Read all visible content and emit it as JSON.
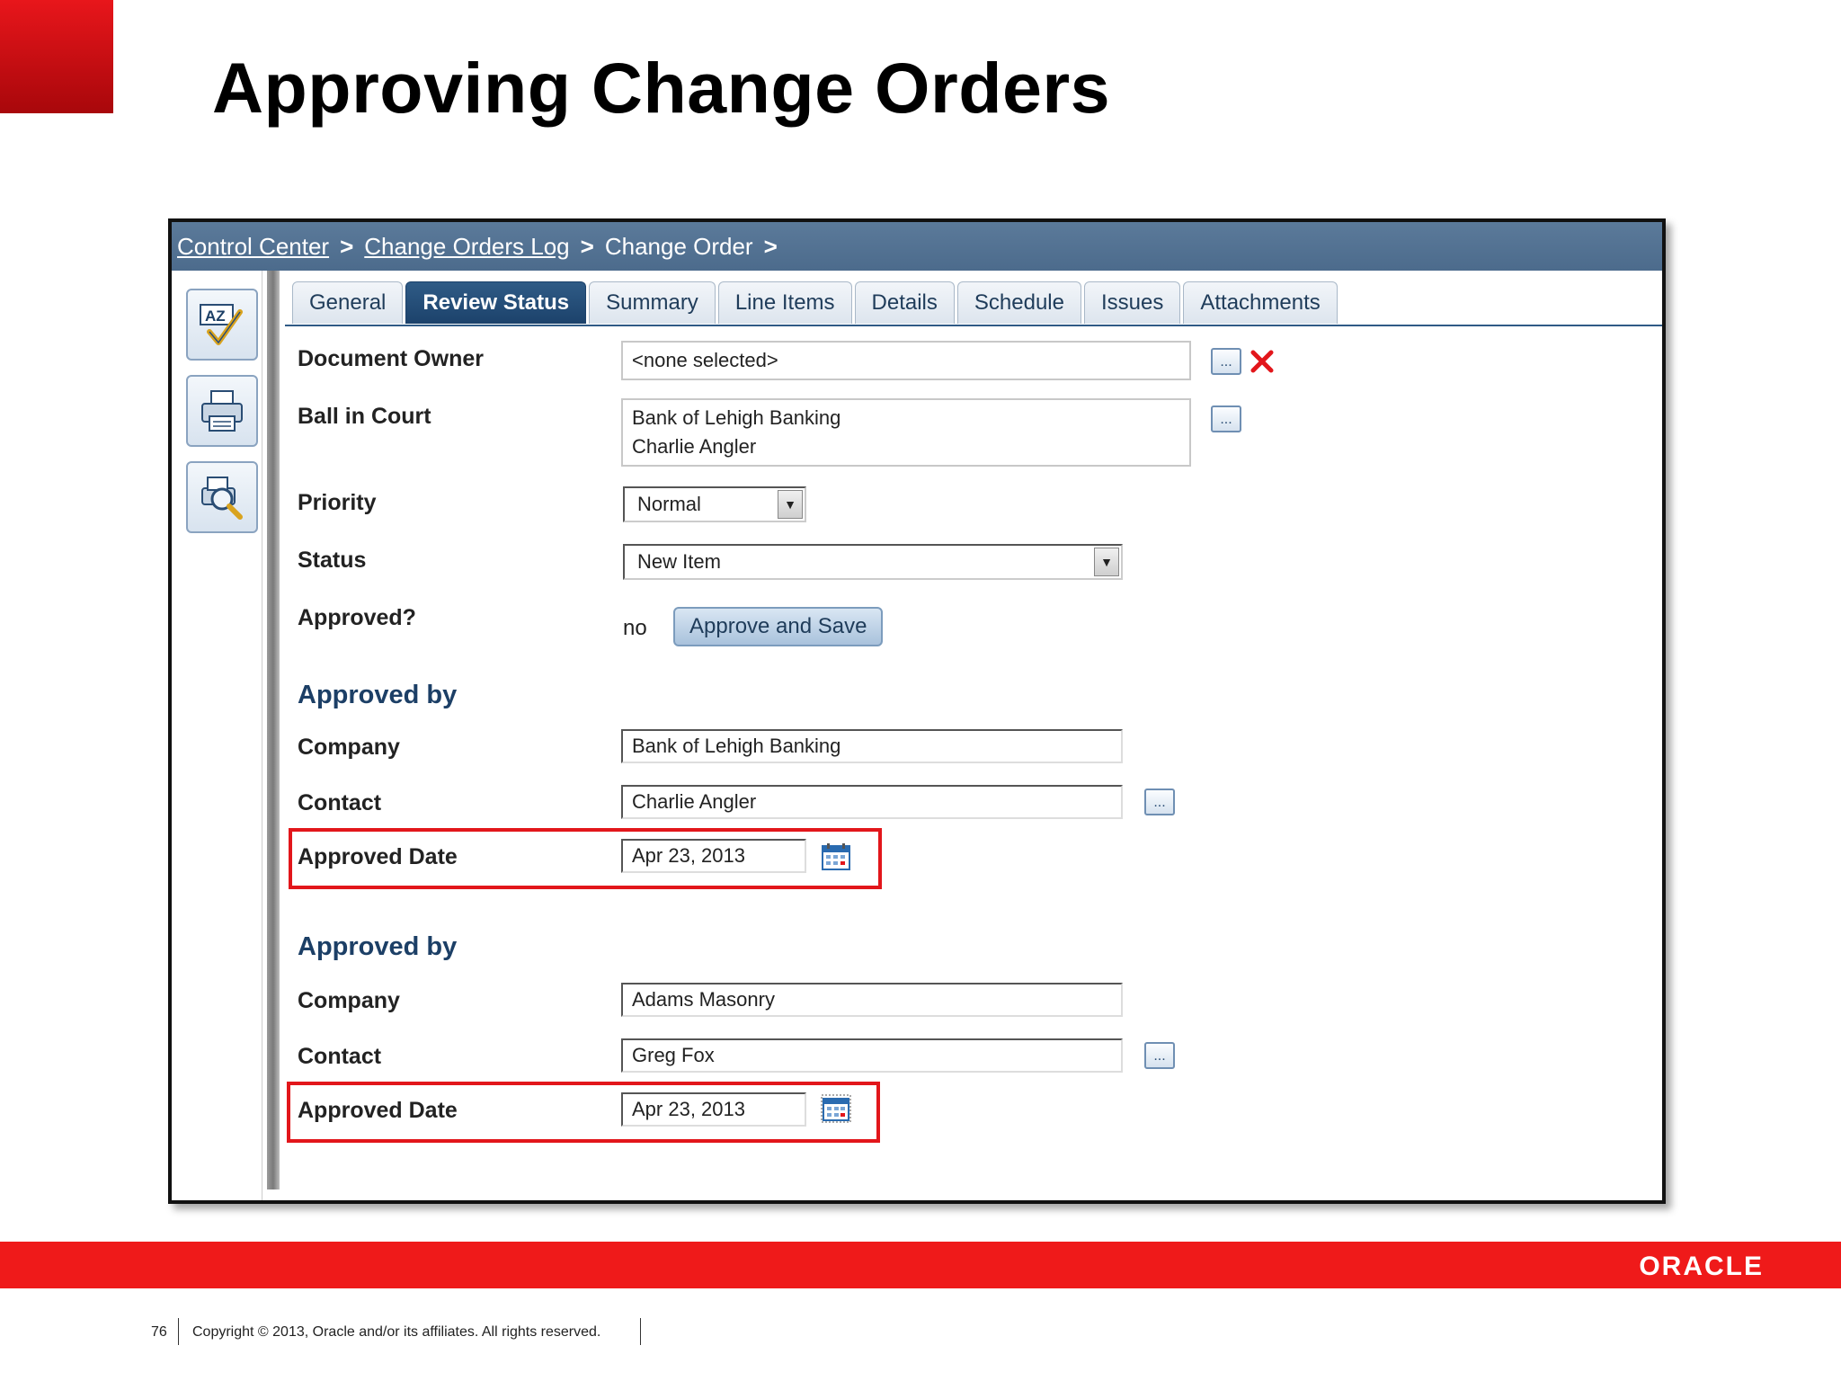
{
  "slide": {
    "title": "Approving Change Orders",
    "page_number": "76",
    "copyright": "Copyright © 2013, Oracle and/or its affiliates. All rights reserved.",
    "logo_text": "ORACLE",
    "brand_color": "#ef1a1a"
  },
  "breadcrumb": {
    "items": [
      "Control Center",
      "Change Orders Log",
      "Change Order"
    ],
    "separator": ">"
  },
  "toolbar": {
    "icons": [
      "spell-check-icon",
      "print-icon",
      "print-preview-icon"
    ]
  },
  "tabs": [
    {
      "label": "General",
      "active": false
    },
    {
      "label": "Review Status",
      "active": true
    },
    {
      "label": "Summary",
      "active": false
    },
    {
      "label": "Line Items",
      "active": false
    },
    {
      "label": "Details",
      "active": false
    },
    {
      "label": "Schedule",
      "active": false
    },
    {
      "label": "Issues",
      "active": false
    },
    {
      "label": "Attachments",
      "active": false
    }
  ],
  "form": {
    "document_owner": {
      "label": "Document Owner",
      "value": "<none selected>"
    },
    "ball_in_court": {
      "label": "Ball in Court",
      "line1": "Bank of Lehigh Banking",
      "line2": "Charlie Angler"
    },
    "priority": {
      "label": "Priority",
      "value": "Normal"
    },
    "status": {
      "label": "Status",
      "value": "New Item"
    },
    "approved": {
      "label": "Approved?",
      "value": "no",
      "button": "Approve and Save"
    },
    "picker_label": "...",
    "approvers": [
      {
        "heading": "Approved by",
        "company_label": "Company",
        "company": "Bank of Lehigh Banking",
        "contact_label": "Contact",
        "contact": "Charlie Angler",
        "date_label": "Approved Date",
        "date": "Apr 23, 2013"
      },
      {
        "heading": "Approved by",
        "company_label": "Company",
        "company": "Adams Masonry",
        "contact_label": "Contact",
        "contact": "Greg Fox",
        "date_label": "Approved Date",
        "date": "Apr 23, 2013"
      }
    ]
  },
  "colors": {
    "header_bar": "#4c6b8c",
    "active_tab": "#1c426b",
    "highlight": "#e2161b"
  }
}
